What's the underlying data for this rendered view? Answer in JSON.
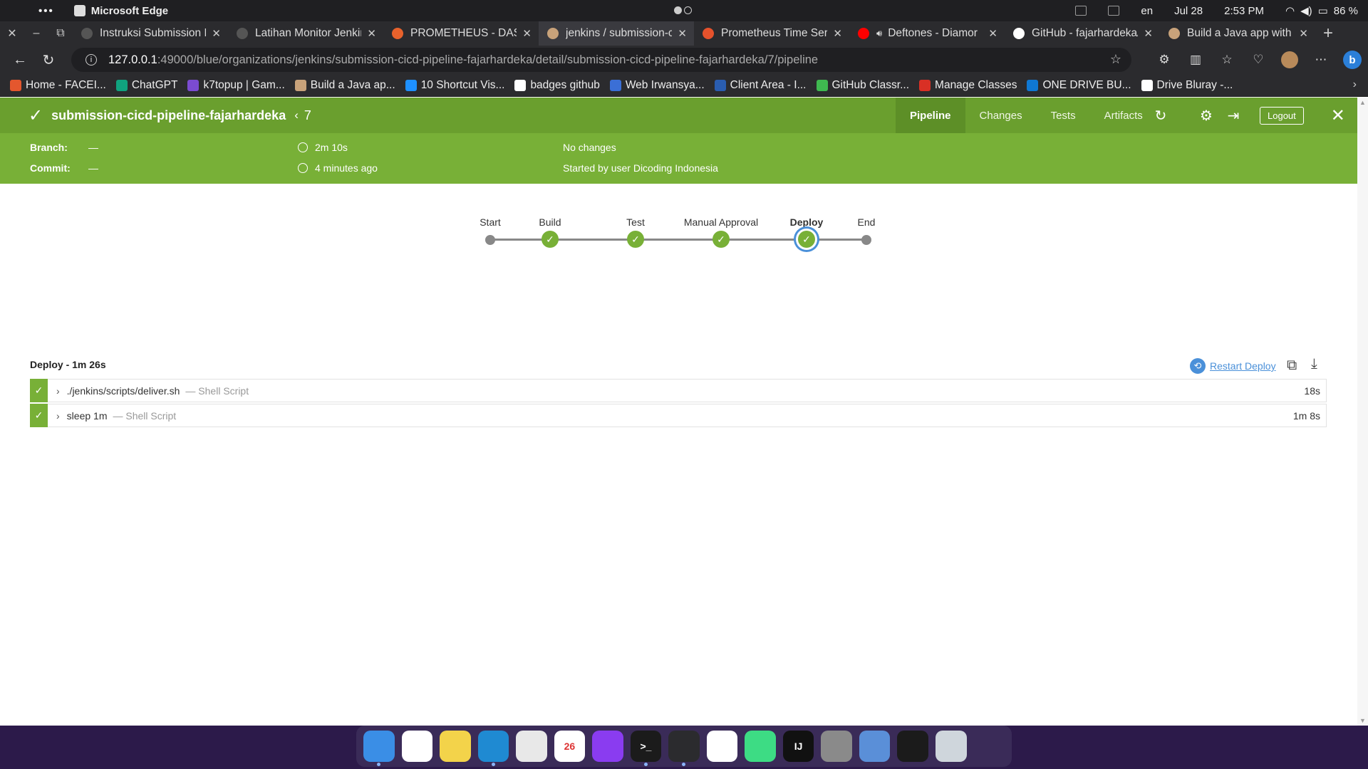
{
  "menubar": {
    "app_name": "Microsoft Edge",
    "lang": "en",
    "date": "Jul 28",
    "time": "2:53 PM",
    "battery": "86 %"
  },
  "tabs": [
    {
      "title": "Instruksi Submission P",
      "icon_color": "#555555",
      "icon": "dicoding-icon"
    },
    {
      "title": "Latihan Monitor Jenkir",
      "icon_color": "#555555",
      "icon": "dicoding-icon"
    },
    {
      "title": "PROMETHEUS - DASH",
      "icon_color": "#e8622c",
      "icon": "grafana-icon"
    },
    {
      "title": "jenkins / submission-c",
      "icon_color": "#c8a27a",
      "icon": "jenkins-icon",
      "active": true
    },
    {
      "title": "Prometheus Time Seri",
      "icon_color": "#e6522c",
      "icon": "prometheus-icon"
    },
    {
      "title": "Deftones - Diamor",
      "icon_color": "#ff0000",
      "icon": "youtube-icon"
    },
    {
      "title": "GitHub - fajarhardeka/",
      "icon_color": "#ffffff",
      "icon": "github-icon"
    },
    {
      "title": "Build a Java app with M",
      "icon_color": "#c8a27a",
      "icon": "jenkins-icon"
    }
  ],
  "address": {
    "host": "127.0.0.1",
    "path": ":49000/blue/organizations/jenkins/submission-cicd-pipeline-fajarhardeka/detail/submission-cicd-pipeline-fajarhardeka/7/pipeline"
  },
  "bookmarks": [
    {
      "label": "Home - FACEI...",
      "icon_color": "#e4572e"
    },
    {
      "label": "ChatGPT",
      "icon_color": "#10a37f"
    },
    {
      "label": "k7topup | Gam...",
      "icon_color": "#7b4bd1"
    },
    {
      "label": "Build a Java ap...",
      "icon_color": "#c8a27a"
    },
    {
      "label": "10 Shortcut Vis...",
      "icon_color": "#1e90ff"
    },
    {
      "label": "badges github",
      "icon_color": "#ffffff"
    },
    {
      "label": "Web Irwansya...",
      "icon_color": "#3b6fd6"
    },
    {
      "label": "Client Area - I...",
      "icon_color": "#2a5db0"
    },
    {
      "label": "GitHub Classr...",
      "icon_color": "#3fb950"
    },
    {
      "label": "Manage Classes",
      "icon_color": "#d93025"
    },
    {
      "label": "ONE DRIVE BU...",
      "icon_color": "#0f78d4"
    },
    {
      "label": "Drive Bluray -...",
      "icon_color": "#ffffff"
    }
  ],
  "jenkins": {
    "job_name": "submission-cicd-pipeline-fajarhardeka",
    "run_number": "7",
    "nav": {
      "pipeline": "Pipeline",
      "changes": "Changes",
      "tests": "Tests",
      "artifacts": "Artifacts"
    },
    "logout": "Logout",
    "summary": {
      "branch_label": "Branch:",
      "branch_value": "—",
      "commit_label": "Commit:",
      "commit_value": "—",
      "duration": "2m 10s",
      "started": "4 minutes ago",
      "changes": "No changes",
      "started_by": "Started by user Dicoding Indonesia"
    },
    "stages": [
      {
        "name": "Start",
        "kind": "terminal"
      },
      {
        "name": "Build",
        "kind": "success"
      },
      {
        "name": "Test",
        "kind": "success"
      },
      {
        "name": "Manual Approval",
        "kind": "success"
      },
      {
        "name": "Deploy",
        "kind": "success",
        "selected": true
      },
      {
        "name": "End",
        "kind": "terminal"
      }
    ],
    "steps_title": "Deploy - 1m 26s",
    "restart_label": "Restart Deploy",
    "steps": [
      {
        "name": "./jenkins/scripts/deliver.sh",
        "type": "— Shell Script",
        "duration": "18s"
      },
      {
        "name": "sleep 1m",
        "type": "— Shell Script",
        "duration": "1m 8s"
      }
    ]
  },
  "dock": [
    {
      "name": "finder",
      "color": "#3a8ee6",
      "glyph": "",
      "running": true
    },
    {
      "name": "chrome",
      "color": "#ffffff",
      "glyph": ""
    },
    {
      "name": "notes",
      "color": "#f3d34a",
      "glyph": ""
    },
    {
      "name": "edge",
      "color": "#1f8ad2",
      "glyph": "",
      "running": true
    },
    {
      "name": "textedit",
      "color": "#e8e8e8",
      "glyph": ""
    },
    {
      "name": "calendar",
      "color": "#ffffff",
      "glyph": "26"
    },
    {
      "name": "infinity",
      "color": "#8a3cf0",
      "glyph": ""
    },
    {
      "name": "terminal",
      "color": "#1b1b1b",
      "glyph": ">_",
      "running": true
    },
    {
      "name": "vscode",
      "color": "#2b2b2e",
      "glyph": "",
      "running": true
    },
    {
      "name": "app-store",
      "color": "#ffffff",
      "glyph": ""
    },
    {
      "name": "android-studio",
      "color": "#3ddc84",
      "glyph": ""
    },
    {
      "name": "intellij",
      "color": "#111111",
      "glyph": "IJ"
    },
    {
      "name": "system-settings",
      "color": "#8a8a8a",
      "glyph": ""
    },
    {
      "name": "control-center",
      "color": "#5a8fd8",
      "glyph": ""
    },
    {
      "name": "activity-monitor",
      "color": "#1b1b1b",
      "glyph": ""
    },
    {
      "name": "trash",
      "color": "#cfd6dc",
      "glyph": ""
    },
    {
      "name": "launchpad",
      "color": "transparent",
      "glyph": ""
    }
  ]
}
